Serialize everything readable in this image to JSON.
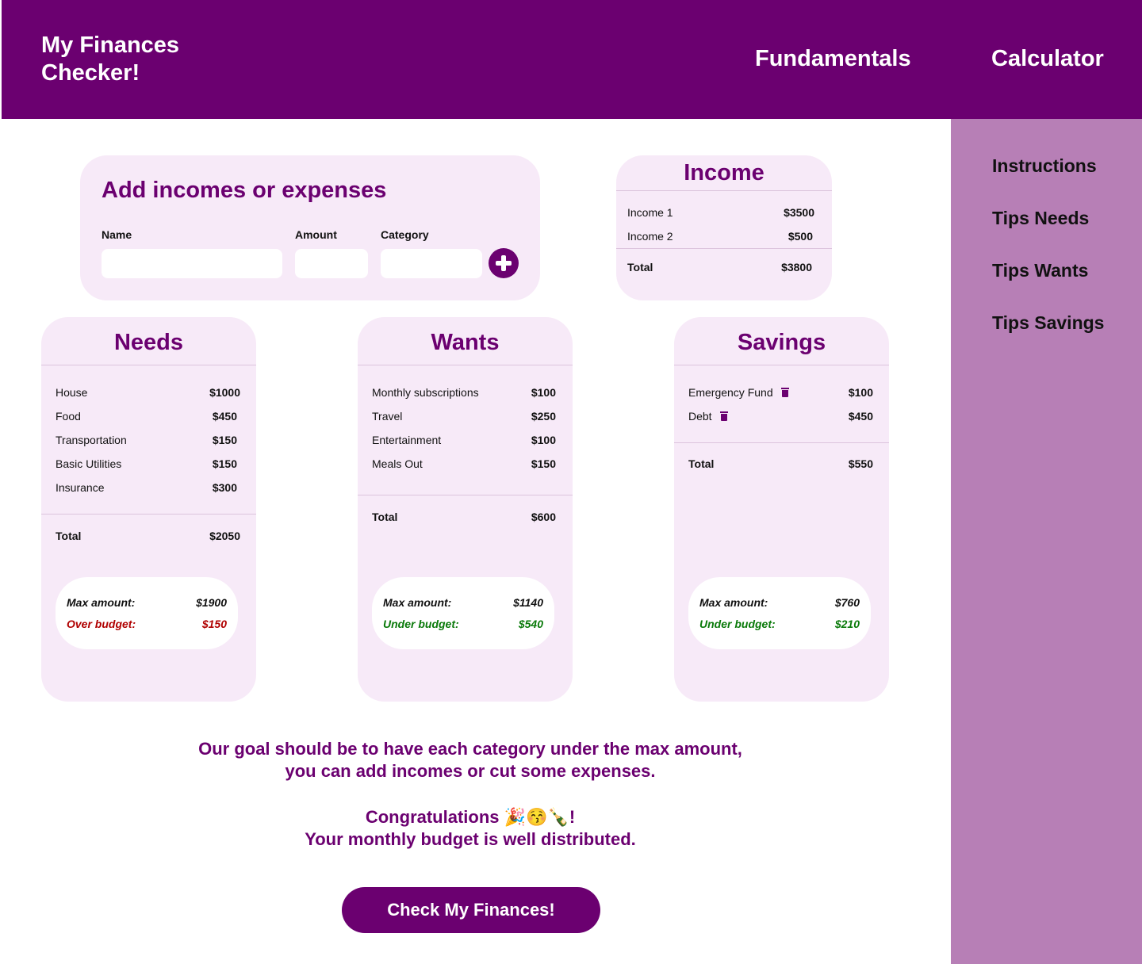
{
  "header": {
    "brand": "My Finances Checker!",
    "nav": [
      {
        "label": "Fundamentals"
      },
      {
        "label": "Calculator"
      }
    ]
  },
  "sidebar": {
    "items": [
      {
        "label": "Instructions"
      },
      {
        "label": "Tips Needs"
      },
      {
        "label": "Tips Wants"
      },
      {
        "label": "Tips Savings"
      }
    ]
  },
  "add_form": {
    "title": "Add incomes or expenses",
    "name_label": "Name",
    "amount_label": "Amount",
    "category_label": "Category",
    "name_value": "",
    "amount_value": "",
    "category_value": "",
    "add_icon": "plus-circle-icon"
  },
  "income": {
    "title": "Income",
    "rows": [
      {
        "name": "Income 1",
        "value": "$3500"
      },
      {
        "name": "Income 2",
        "value": "$500"
      }
    ],
    "total_label": "Total",
    "total_value": "$3800"
  },
  "needs": {
    "title": "Needs",
    "rows": [
      {
        "name": "House",
        "value": "$1000"
      },
      {
        "name": "Food",
        "value": "$450"
      },
      {
        "name": "Transportation",
        "value": "$150"
      },
      {
        "name": "Basic Utilities",
        "value": "$150"
      },
      {
        "name": "Insurance",
        "value": "$300"
      }
    ],
    "total_label": "Total",
    "total_value": "$2050",
    "max_label": "Max amount:",
    "max_value": "$1900",
    "status_label": "Over budget:",
    "status_value": "$150",
    "status_color": "#b00000"
  },
  "wants": {
    "title": "Wants",
    "rows": [
      {
        "name": "Monthly subscriptions",
        "value": "$100"
      },
      {
        "name": "Travel",
        "value": "$250"
      },
      {
        "name": "Entertainment",
        "value": "$100"
      },
      {
        "name": "Meals Out",
        "value": "$150"
      }
    ],
    "total_label": "Total",
    "total_value": "$600",
    "max_label": "Max amount:",
    "max_value": "$1140",
    "status_label": "Under budget:",
    "status_value": "$540",
    "status_color": "#0a7a0a"
  },
  "savings": {
    "title": "Savings",
    "rows": [
      {
        "name": "Emergency Fund",
        "value": "$100",
        "icon": "trash-icon"
      },
      {
        "name": "Debt",
        "value": "$450",
        "icon": "trash-icon"
      }
    ],
    "total_label": "Total",
    "total_value": "$550",
    "max_label": "Max amount:",
    "max_value": "$760",
    "status_label": "Under budget:",
    "status_value": "$210",
    "status_color": "#0a7a0a"
  },
  "message": {
    "goal_line1": "Our goal should be to have each category under the max amount,",
    "goal_line2": "you can add incomes or cut some expenses.",
    "congrats_line1": "Congratulations 🎉😚🍾!",
    "congrats_line2": "Your monthly budget is well distributed."
  },
  "cta": {
    "label": "Check My Finances!"
  },
  "colors": {
    "brand": "#6b0070",
    "sidebar": "#b77fb6",
    "card": "#f7eaf8"
  }
}
